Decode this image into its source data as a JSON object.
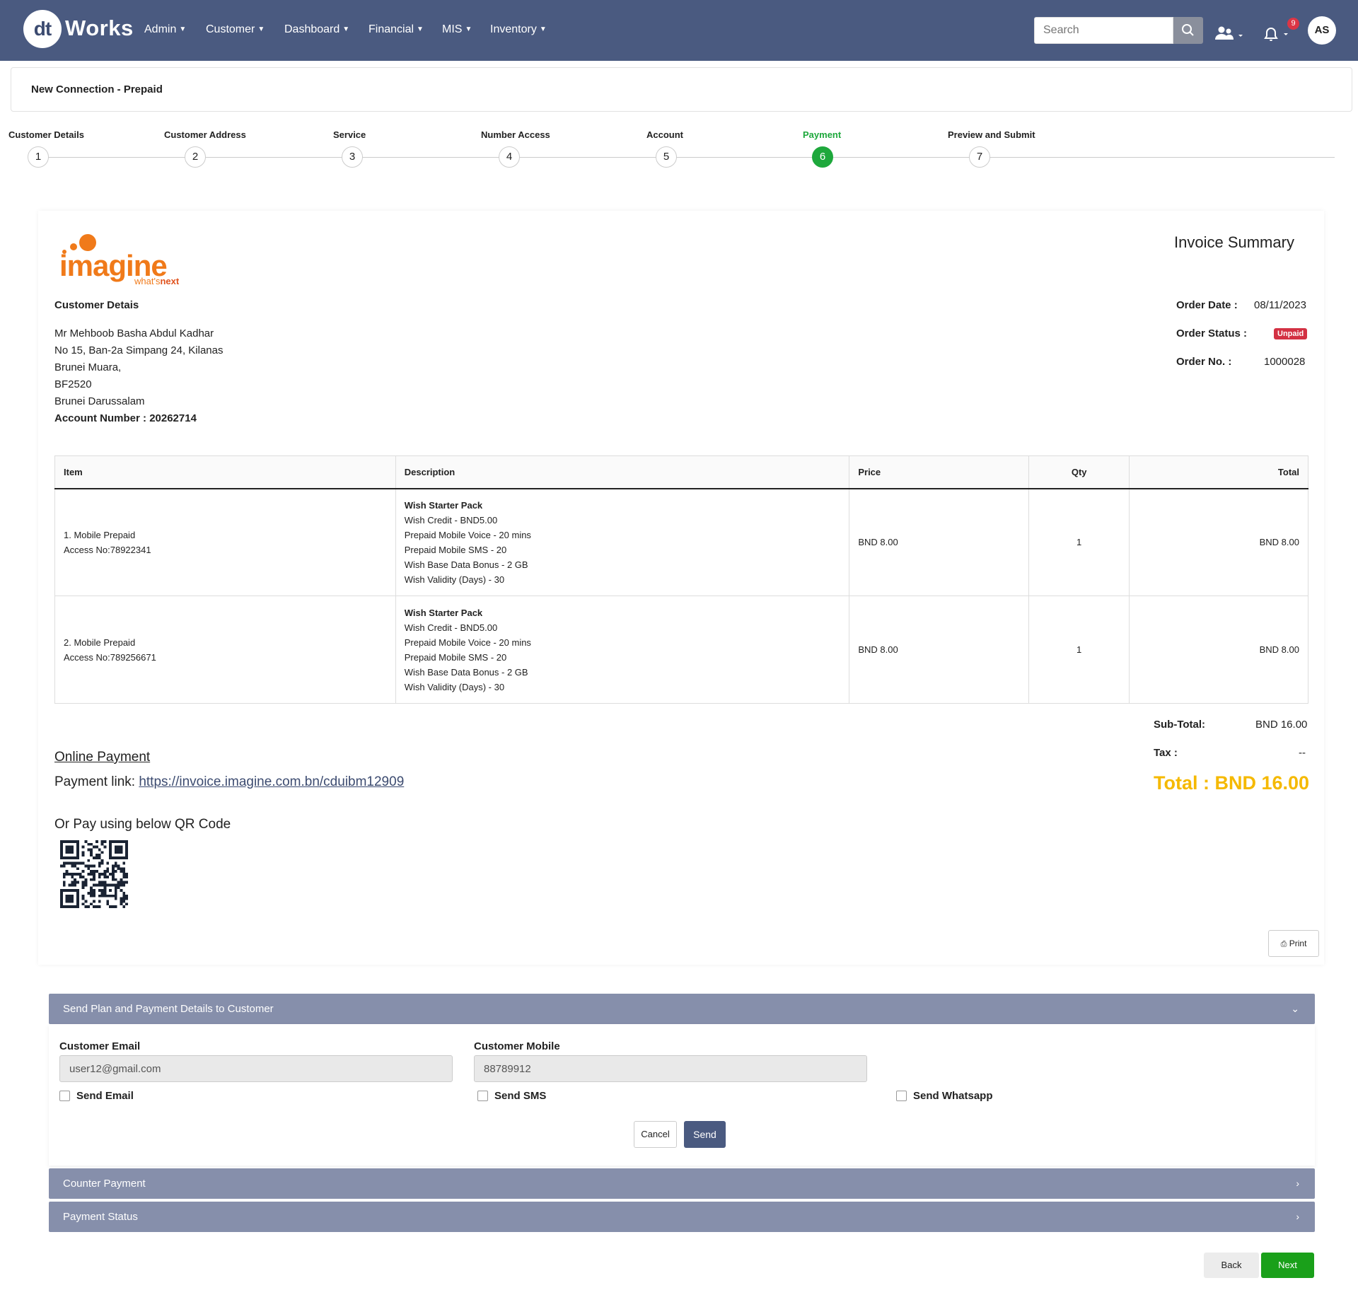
{
  "nav": {
    "logo_mark": "dt",
    "logo_text": "Works",
    "menu": [
      {
        "label": "Admin"
      },
      {
        "label": "Customer"
      },
      {
        "label": "Dashboard"
      },
      {
        "label": "Financial"
      },
      {
        "label": "MIS"
      },
      {
        "label": "Inventory"
      }
    ],
    "search_placeholder": "Search",
    "notification_count": "9",
    "avatar_initials": "AS"
  },
  "page_title": "New Connection - Prepaid",
  "stepper": {
    "steps": [
      {
        "num": "1",
        "label": "Customer Details"
      },
      {
        "num": "2",
        "label": "Customer Address"
      },
      {
        "num": "3",
        "label": "Service"
      },
      {
        "num": "4",
        "label": "Number Access"
      },
      {
        "num": "5",
        "label": "Account"
      },
      {
        "num": "6",
        "label": "Payment"
      },
      {
        "num": "7",
        "label": "Preview and Submit"
      }
    ],
    "active_step": 6
  },
  "invoice": {
    "brand": {
      "name": "imagine",
      "tagline_a": "what's",
      "tagline_b": "next"
    },
    "heading": "Invoice Summary",
    "customer_section_title": "Customer Detais",
    "customer": {
      "name": "Mr Mehboob Basha Abdul Kadhar",
      "address1": "No 15, Ban-2a Simpang 24, Kilanas",
      "address2": "Brunei Muara,",
      "postcode": "BF2520",
      "country": "Brunei Darussalam",
      "account_label": "Account Number :",
      "account_number": "20262714"
    },
    "order": {
      "date_label": "Order Date :",
      "date": "08/11/2023",
      "status_label": "Order Status :",
      "status": "Unpaid",
      "number_label": "Order No. :",
      "number": "1000028"
    },
    "table": {
      "headers": [
        "Item",
        "Description",
        "Price",
        "Qty",
        "Total"
      ],
      "rows": [
        {
          "item": "1. Mobile Prepaid",
          "access": "Access No:78922341",
          "desc_title": "Wish Starter Pack",
          "desc_lines": [
            "Wish Credit - BND5.00",
            "Prepaid Mobile Voice - 20 mins",
            "Prepaid Mobile SMS - 20",
            "Wish Base Data Bonus - 2 GB",
            "Wish Validity (Days) - 30"
          ],
          "price": "BND 8.00",
          "qty": "1",
          "total": "BND 8.00"
        },
        {
          "item": "2. Mobile Prepaid",
          "access": "Access No:789256671",
          "desc_title": "Wish Starter Pack",
          "desc_lines": [
            "Wish Credit - BND5.00",
            "Prepaid Mobile Voice - 20 mins",
            "Prepaid Mobile SMS - 20",
            "Wish Base Data Bonus - 2 GB",
            "Wish Validity (Days) - 30"
          ],
          "price": "BND 8.00",
          "qty": "1",
          "total": "BND 8.00"
        }
      ]
    },
    "totals": {
      "subtotal_label": "Sub-Total:",
      "subtotal": "BND 16.00",
      "tax_label": "Tax :",
      "tax": "--",
      "total": "Total : BND 16.00"
    },
    "online_payment_title": "Online Payment",
    "payment_link_label": "Payment link:",
    "payment_link": "https://invoice.imagine.com.bn/cduibm12909",
    "qr_caption": "Or Pay using below QR Code",
    "print_label": "Print"
  },
  "send_panel": {
    "title": "Send Plan and Payment Details to Customer",
    "email_label": "Customer Email",
    "email_value": "user12@gmail.com",
    "mobile_label": "Customer Mobile",
    "mobile_value": "88789912",
    "send_email": "Send Email",
    "send_sms": "Send SMS",
    "send_whatsapp": "Send Whatsapp",
    "cancel": "Cancel",
    "send": "Send"
  },
  "accordions": {
    "counter_payment": "Counter Payment",
    "payment_status": "Payment Status"
  },
  "footer": {
    "back": "Back",
    "next": "Next"
  },
  "colors": {
    "navbar": "#4a5a80",
    "accordion": "#868fab",
    "active_step": "#1ea83c",
    "total": "#f5b900",
    "unpaid": "#d33143",
    "brand_orange": "#f07a1a"
  }
}
